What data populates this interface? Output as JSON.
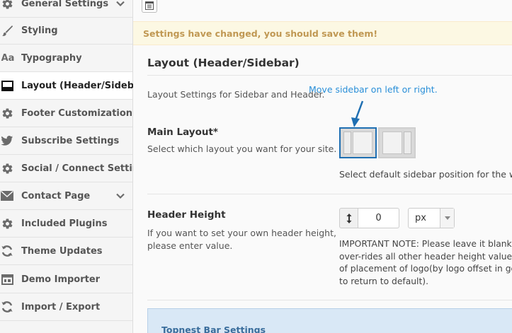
{
  "sidebar": {
    "items": [
      {
        "label": "General Settings",
        "icon": "gear-icon",
        "has_chevron": true
      },
      {
        "label": "Styling",
        "icon": "brush-icon"
      },
      {
        "label": "Typography",
        "icon": "typography-icon",
        "icon_text": "Aa"
      },
      {
        "label": "Layout (Header/Sidebar)",
        "icon": "layout-icon",
        "active": true
      },
      {
        "label": "Footer Customization",
        "icon": "gear-icon"
      },
      {
        "label": "Subscribe Settings",
        "icon": "twitter-bird-icon"
      },
      {
        "label": "Social / Connect Settings",
        "icon": "gear-icon"
      },
      {
        "label": "Contact Page",
        "icon": "envelope-icon",
        "has_chevron": true
      },
      {
        "label": "Included Plugins",
        "icon": "gear-icon"
      },
      {
        "label": "Theme Updates",
        "icon": "refresh-icon"
      },
      {
        "label": "Demo Importer",
        "icon": "window-icon"
      },
      {
        "label": "Import / Export",
        "icon": "refresh-icon"
      }
    ]
  },
  "notice": {
    "text": "Settings have changed, you should save them!"
  },
  "section": {
    "title": "Layout (Header/Sidebar)",
    "description": "Layout Settings for Sidebar and Header."
  },
  "annotation": {
    "text": "Move sidebar on left or right."
  },
  "main_layout": {
    "label": "Main Layout*",
    "description": "Select which layout you want for your site.",
    "help": "Select default sidebar position for the we",
    "selected": "left-sidebar"
  },
  "header_height": {
    "label": "Header Height",
    "description_lines": [
      "If you want to set your own header height,",
      "please enter value."
    ],
    "value": "0",
    "unit": "px",
    "note_lines": [
      "IMPORTANT NOTE: Please leave it blank",
      "over-rides all other header height values",
      "of placement of logo(by logo offset in ge",
      "to return to default)."
    ]
  },
  "next_section": {
    "title": "Topnest Bar Settings"
  },
  "colors": {
    "accent": "#1f6fb2",
    "annotation": "#2a8fd8",
    "notice_bg": "#fcf8e3",
    "notice_text": "#c09853",
    "panel_bg": "#d9e8f6"
  }
}
